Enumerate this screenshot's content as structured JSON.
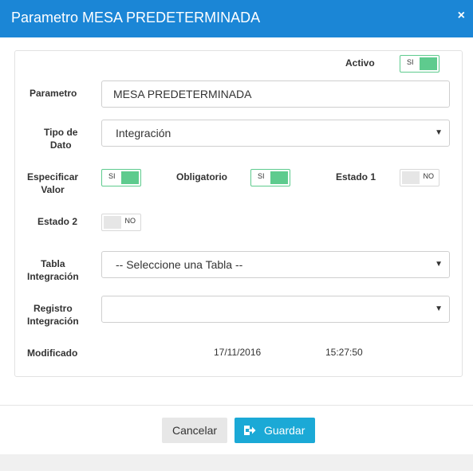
{
  "dialog": {
    "title": "Parametro MESA PREDETERMINADA",
    "close_glyph": "×"
  },
  "form": {
    "activo": {
      "label": "Activo",
      "state": "on",
      "toggle_text": "SI"
    },
    "parametro": {
      "label": "Parametro",
      "value": "MESA PREDETERMINADA"
    },
    "tipo_dato": {
      "label_line1": "Tipo de",
      "label_line2": "Dato",
      "selected": "Integración"
    },
    "especificar_valor": {
      "label_line1": "Especificar",
      "label_line2": "Valor",
      "state": "on",
      "toggle_text": "SI"
    },
    "obligatorio": {
      "label": "Obligatorio",
      "state": "on",
      "toggle_text": "SI"
    },
    "estado1": {
      "label": "Estado 1",
      "state": "off",
      "toggle_text": "NO"
    },
    "estado2": {
      "label": "Estado 2",
      "state": "off",
      "toggle_text": "NO"
    },
    "tabla_integracion": {
      "label_line1": "Tabla",
      "label_line2": "Integración",
      "selected": "-- Seleccione una Tabla --"
    },
    "registro_integracion": {
      "label_line1": "Registro",
      "label_line2": "Integración",
      "selected": ""
    },
    "modificado": {
      "label": "Modificado",
      "date": "17/11/2016",
      "time": "15:27:50"
    }
  },
  "footer": {
    "cancel_label": "Cancelar",
    "save_label": "Guardar",
    "save_icon": "save-icon"
  },
  "colors": {
    "titlebar": "#1b86d6",
    "toggle_on": "#5ecb8e",
    "toggle_off": "#e6e6e6",
    "save_button": "#1ba9d6",
    "cancel_button": "#e7e7e7"
  }
}
